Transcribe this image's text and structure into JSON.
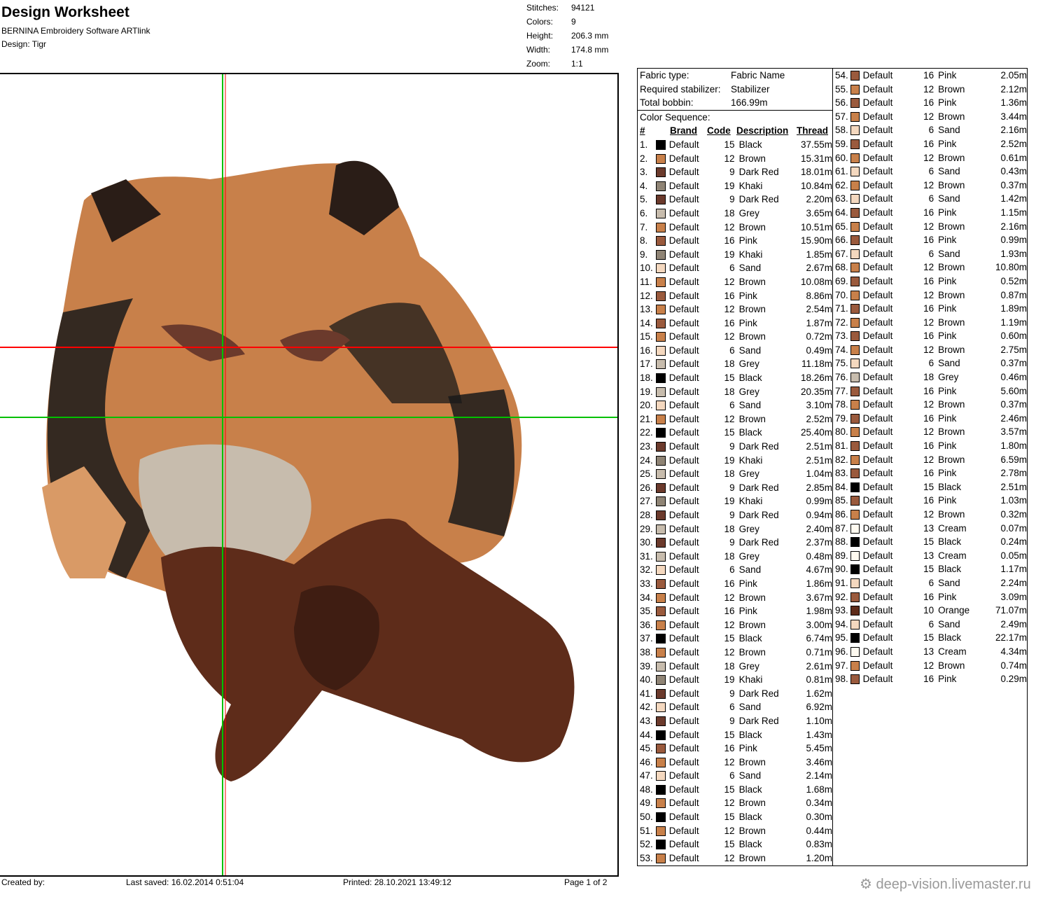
{
  "header": {
    "title": "Design Worksheet",
    "software": "BERNINA Embroidery Software ARTlink",
    "design": "Design:  Tigr"
  },
  "stats": [
    {
      "k": "Stitches:",
      "v": "94121"
    },
    {
      "k": "Colors:",
      "v": "9"
    },
    {
      "k": "Height:",
      "v": "206.3 mm"
    },
    {
      "k": "Width:",
      "v": "174.8 mm"
    },
    {
      "k": "Zoom:",
      "v": "1:1"
    }
  ],
  "footer": {
    "created": "Created by:",
    "saved": "Last saved: 16.02.2014 0:51:04",
    "printed": "Printed: 28.10.2021 13:49:12",
    "page": "Page 1 of 2"
  },
  "info": {
    "fabric_label": "Fabric type:",
    "fabric_value": "Fabric Name",
    "stab_label": "Required stabilizer:",
    "stab_value": "Stabilizer",
    "bobbin_label": "Total bobbin:",
    "bobbin_value": "166.99m",
    "seq_label": "Color Sequence:",
    "h_num": "#",
    "h_brand": "Brand",
    "h_code": "Code",
    "h_desc": "Description",
    "h_thread": "Thread"
  },
  "colors": {
    "Black": "#000000",
    "Brown": "#c8804a",
    "Dark Red": "#6b3a2c",
    "Khaki": "#8f8475",
    "Grey": "#c7bcad",
    "Pink": "#9a5a3d",
    "Sand": "#f4d8bf",
    "Cream": "#fffaf0",
    "Orange": "#5e2c1a"
  },
  "rows": [
    [
      "1.",
      "Default",
      "15",
      "Black",
      "37.55m"
    ],
    [
      "2.",
      "Default",
      "12",
      "Brown",
      "15.31m"
    ],
    [
      "3.",
      "Default",
      "9",
      "Dark Red",
      "18.01m"
    ],
    [
      "4.",
      "Default",
      "19",
      "Khaki",
      "10.84m"
    ],
    [
      "5.",
      "Default",
      "9",
      "Dark Red",
      "2.20m"
    ],
    [
      "6.",
      "Default",
      "18",
      "Grey",
      "3.65m"
    ],
    [
      "7.",
      "Default",
      "12",
      "Brown",
      "10.51m"
    ],
    [
      "8.",
      "Default",
      "16",
      "Pink",
      "15.90m"
    ],
    [
      "9.",
      "Default",
      "19",
      "Khaki",
      "1.85m"
    ],
    [
      "10.",
      "Default",
      "6",
      "Sand",
      "2.67m"
    ],
    [
      "11.",
      "Default",
      "12",
      "Brown",
      "10.08m"
    ],
    [
      "12.",
      "Default",
      "16",
      "Pink",
      "8.86m"
    ],
    [
      "13.",
      "Default",
      "12",
      "Brown",
      "2.54m"
    ],
    [
      "14.",
      "Default",
      "16",
      "Pink",
      "1.87m"
    ],
    [
      "15.",
      "Default",
      "12",
      "Brown",
      "0.72m"
    ],
    [
      "16.",
      "Default",
      "6",
      "Sand",
      "0.49m"
    ],
    [
      "17.",
      "Default",
      "18",
      "Grey",
      "11.18m"
    ],
    [
      "18.",
      "Default",
      "15",
      "Black",
      "18.26m"
    ],
    [
      "19.",
      "Default",
      "18",
      "Grey",
      "20.35m"
    ],
    [
      "20.",
      "Default",
      "6",
      "Sand",
      "3.10m"
    ],
    [
      "21.",
      "Default",
      "12",
      "Brown",
      "2.52m"
    ],
    [
      "22.",
      "Default",
      "15",
      "Black",
      "25.40m"
    ],
    [
      "23.",
      "Default",
      "9",
      "Dark Red",
      "2.51m"
    ],
    [
      "24.",
      "Default",
      "19",
      "Khaki",
      "2.51m"
    ],
    [
      "25.",
      "Default",
      "18",
      "Grey",
      "1.04m"
    ],
    [
      "26.",
      "Default",
      "9",
      "Dark Red",
      "2.85m"
    ],
    [
      "27.",
      "Default",
      "19",
      "Khaki",
      "0.99m"
    ],
    [
      "28.",
      "Default",
      "9",
      "Dark Red",
      "0.94m"
    ],
    [
      "29.",
      "Default",
      "18",
      "Grey",
      "2.40m"
    ],
    [
      "30.",
      "Default",
      "9",
      "Dark Red",
      "2.37m"
    ],
    [
      "31.",
      "Default",
      "18",
      "Grey",
      "0.48m"
    ],
    [
      "32.",
      "Default",
      "6",
      "Sand",
      "4.67m"
    ],
    [
      "33.",
      "Default",
      "16",
      "Pink",
      "1.86m"
    ],
    [
      "34.",
      "Default",
      "12",
      "Brown",
      "3.67m"
    ],
    [
      "35.",
      "Default",
      "16",
      "Pink",
      "1.98m"
    ],
    [
      "36.",
      "Default",
      "12",
      "Brown",
      "3.00m"
    ],
    [
      "37.",
      "Default",
      "15",
      "Black",
      "6.74m"
    ],
    [
      "38.",
      "Default",
      "12",
      "Brown",
      "0.71m"
    ],
    [
      "39.",
      "Default",
      "18",
      "Grey",
      "2.61m"
    ],
    [
      "40.",
      "Default",
      "19",
      "Khaki",
      "0.81m"
    ],
    [
      "41.",
      "Default",
      "9",
      "Dark Red",
      "1.62m"
    ],
    [
      "42.",
      "Default",
      "6",
      "Sand",
      "6.92m"
    ],
    [
      "43.",
      "Default",
      "9",
      "Dark Red",
      "1.10m"
    ],
    [
      "44.",
      "Default",
      "15",
      "Black",
      "1.43m"
    ],
    [
      "45.",
      "Default",
      "16",
      "Pink",
      "5.45m"
    ],
    [
      "46.",
      "Default",
      "12",
      "Brown",
      "3.46m"
    ],
    [
      "47.",
      "Default",
      "6",
      "Sand",
      "2.14m"
    ],
    [
      "48.",
      "Default",
      "15",
      "Black",
      "1.68m"
    ],
    [
      "49.",
      "Default",
      "12",
      "Brown",
      "0.34m"
    ],
    [
      "50.",
      "Default",
      "15",
      "Black",
      "0.30m"
    ],
    [
      "51.",
      "Default",
      "12",
      "Brown",
      "0.44m"
    ],
    [
      "52.",
      "Default",
      "15",
      "Black",
      "0.83m"
    ],
    [
      "53.",
      "Default",
      "12",
      "Brown",
      "1.20m"
    ],
    [
      "54.",
      "Default",
      "16",
      "Pink",
      "2.05m"
    ],
    [
      "55.",
      "Default",
      "12",
      "Brown",
      "2.12m"
    ],
    [
      "56.",
      "Default",
      "16",
      "Pink",
      "1.36m"
    ],
    [
      "57.",
      "Default",
      "12",
      "Brown",
      "3.44m"
    ],
    [
      "58.",
      "Default",
      "6",
      "Sand",
      "2.16m"
    ],
    [
      "59.",
      "Default",
      "16",
      "Pink",
      "2.52m"
    ],
    [
      "60.",
      "Default",
      "12",
      "Brown",
      "0.61m"
    ],
    [
      "61.",
      "Default",
      "6",
      "Sand",
      "0.43m"
    ],
    [
      "62.",
      "Default",
      "12",
      "Brown",
      "0.37m"
    ],
    [
      "63.",
      "Default",
      "6",
      "Sand",
      "1.42m"
    ],
    [
      "64.",
      "Default",
      "16",
      "Pink",
      "1.15m"
    ],
    [
      "65.",
      "Default",
      "12",
      "Brown",
      "2.16m"
    ],
    [
      "66.",
      "Default",
      "16",
      "Pink",
      "0.99m"
    ],
    [
      "67.",
      "Default",
      "6",
      "Sand",
      "1.93m"
    ],
    [
      "68.",
      "Default",
      "12",
      "Brown",
      "10.80m"
    ],
    [
      "69.",
      "Default",
      "16",
      "Pink",
      "0.52m"
    ],
    [
      "70.",
      "Default",
      "12",
      "Brown",
      "0.87m"
    ],
    [
      "71.",
      "Default",
      "16",
      "Pink",
      "1.89m"
    ],
    [
      "72.",
      "Default",
      "12",
      "Brown",
      "1.19m"
    ],
    [
      "73.",
      "Default",
      "16",
      "Pink",
      "0.60m"
    ],
    [
      "74.",
      "Default",
      "12",
      "Brown",
      "2.75m"
    ],
    [
      "75.",
      "Default",
      "6",
      "Sand",
      "0.37m"
    ],
    [
      "76.",
      "Default",
      "18",
      "Grey",
      "0.46m"
    ],
    [
      "77.",
      "Default",
      "16",
      "Pink",
      "5.60m"
    ],
    [
      "78.",
      "Default",
      "12",
      "Brown",
      "0.37m"
    ],
    [
      "79.",
      "Default",
      "16",
      "Pink",
      "2.46m"
    ],
    [
      "80.",
      "Default",
      "12",
      "Brown",
      "3.57m"
    ],
    [
      "81.",
      "Default",
      "16",
      "Pink",
      "1.80m"
    ],
    [
      "82.",
      "Default",
      "12",
      "Brown",
      "6.59m"
    ],
    [
      "83.",
      "Default",
      "16",
      "Pink",
      "2.78m"
    ],
    [
      "84.",
      "Default",
      "15",
      "Black",
      "2.51m"
    ],
    [
      "85.",
      "Default",
      "16",
      "Pink",
      "1.03m"
    ],
    [
      "86.",
      "Default",
      "12",
      "Brown",
      "0.32m"
    ],
    [
      "87.",
      "Default",
      "13",
      "Cream",
      "0.07m"
    ],
    [
      "88.",
      "Default",
      "15",
      "Black",
      "0.24m"
    ],
    [
      "89.",
      "Default",
      "13",
      "Cream",
      "0.05m"
    ],
    [
      "90.",
      "Default",
      "15",
      "Black",
      "1.17m"
    ],
    [
      "91.",
      "Default",
      "6",
      "Sand",
      "2.24m"
    ],
    [
      "92.",
      "Default",
      "16",
      "Pink",
      "3.09m"
    ],
    [
      "93.",
      "Default",
      "10",
      "Orange",
      "71.07m"
    ],
    [
      "94.",
      "Default",
      "6",
      "Sand",
      "2.49m"
    ],
    [
      "95.",
      "Default",
      "15",
      "Black",
      "22.17m"
    ],
    [
      "96.",
      "Default",
      "13",
      "Cream",
      "4.34m"
    ],
    [
      "97.",
      "Default",
      "12",
      "Brown",
      "0.74m"
    ],
    [
      "98.",
      "Default",
      "16",
      "Pink",
      "0.29m"
    ]
  ],
  "watermark": "deep-vision.livemaster.ru"
}
